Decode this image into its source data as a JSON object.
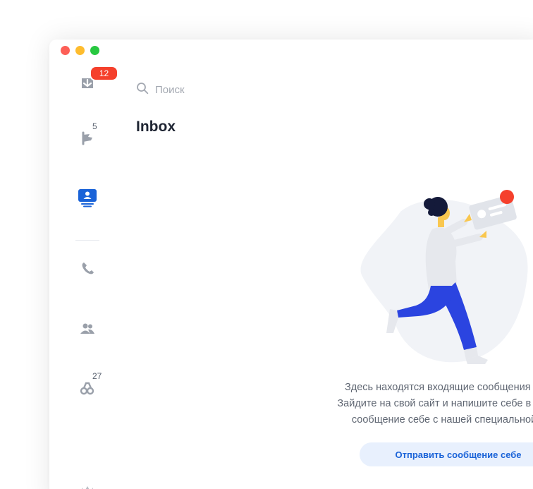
{
  "search": {
    "placeholder": "Поиск"
  },
  "page_title": "Inbox",
  "rail": {
    "inbox_badge": "12",
    "chats_count": "5",
    "visitors_count": "27"
  },
  "empty_state": {
    "line1": "Здесь находятся входящие сообщения от",
    "line2": "Зайдите на свой сайт и напишите себе в чат.",
    "line3": "сообщение себе с нашей специальной",
    "button_label": "Отправить сообщение себе"
  },
  "colors": {
    "accent": "#1a63d8",
    "badge": "#f5402c",
    "illustration_blue": "#2b44e0",
    "illustration_yellow": "#f9c74f"
  }
}
